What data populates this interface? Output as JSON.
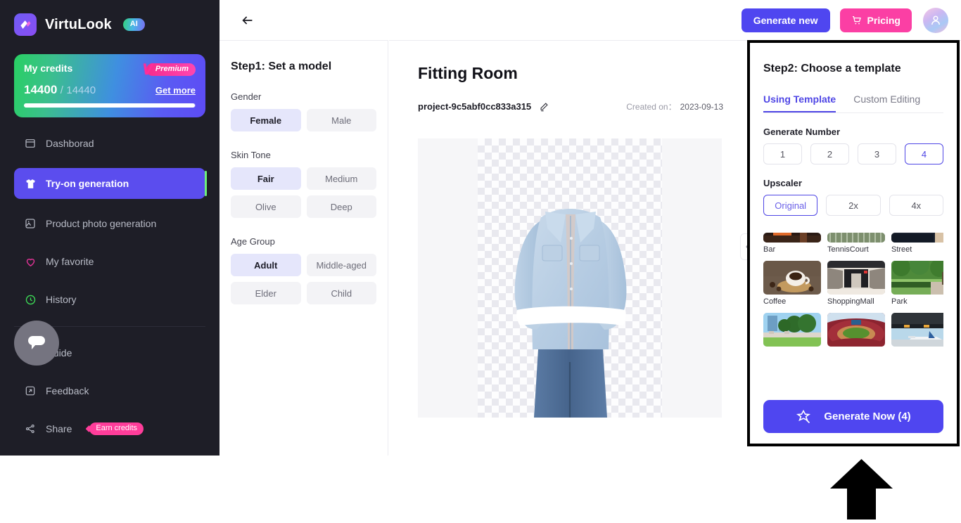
{
  "brand": {
    "name": "VirtuLook",
    "ai_badge": "AI"
  },
  "credits": {
    "title": "My credits",
    "premium_label": "Premium",
    "premium_mark": "V",
    "used": "14400",
    "separator": "/",
    "total": "14440",
    "get_more": "Get more",
    "progress_percent": 99.7
  },
  "sidebar": {
    "items": [
      {
        "label": "Dashborad",
        "icon": "dashboard-icon",
        "active": false
      },
      {
        "label": "Try-on generation",
        "icon": "tshirt-icon",
        "active": true
      },
      {
        "label": "Product photo generation",
        "icon": "image-icon",
        "active": false
      },
      {
        "label": "My favorite",
        "icon": "heart-icon",
        "active": false
      },
      {
        "label": "History",
        "icon": "clock-icon",
        "active": false
      }
    ],
    "bottom_items": [
      {
        "label": "Guide",
        "icon": "question-circle-icon"
      },
      {
        "label": "Feedback",
        "icon": "external-link-icon"
      },
      {
        "label": "Share",
        "icon": "share-icon",
        "badge": "Earn credits"
      }
    ]
  },
  "topbar": {
    "back_icon": "arrow-left-icon",
    "generate_new": "Generate new",
    "pricing": "Pricing",
    "pricing_icon": "cart-icon",
    "avatar_icon": "user-icon"
  },
  "step1": {
    "title": "Step1: Set a model",
    "groups": [
      {
        "label": "Gender",
        "options": [
          {
            "text": "Female",
            "selected": true
          },
          {
            "text": "Male",
            "selected": false
          }
        ]
      },
      {
        "label": "Skin Tone",
        "options": [
          {
            "text": "Fair",
            "selected": true
          },
          {
            "text": "Medium",
            "selected": false
          },
          {
            "text": "Olive",
            "selected": false
          },
          {
            "text": "Deep",
            "selected": false
          }
        ]
      },
      {
        "label": "Age Group",
        "options": [
          {
            "text": "Adult",
            "selected": true
          },
          {
            "text": "Middle-aged",
            "selected": false
          },
          {
            "text": "Elder",
            "selected": false
          },
          {
            "text": "Child",
            "selected": false
          }
        ]
      }
    ]
  },
  "center": {
    "title": "Fitting Room",
    "project_name": "project-9c5abf0cc833a315",
    "edit_icon": "pencil-icon",
    "created_on_label": "Created on：",
    "created_on_value": "2023-09-13",
    "garment_alt": "light-blue denim shirt with jeans on transparent background"
  },
  "step2": {
    "title": "Step2: Choose a template",
    "tabs": [
      {
        "label": "Using Template",
        "active": true
      },
      {
        "label": "Custom Editing",
        "active": false
      }
    ],
    "generate_number_label": "Generate Number",
    "generate_numbers": [
      {
        "text": "1",
        "selected": false
      },
      {
        "text": "2",
        "selected": false
      },
      {
        "text": "3",
        "selected": false
      },
      {
        "text": "4",
        "selected": true
      }
    ],
    "upscaler_label": "Upscaler",
    "upscaler_options": [
      {
        "text": "Original",
        "selected": true
      },
      {
        "text": "2x",
        "selected": false
      },
      {
        "text": "4x",
        "selected": false
      }
    ],
    "templates": [
      {
        "name": "Bar",
        "clipped": true
      },
      {
        "name": "TennisCourt",
        "clipped": true
      },
      {
        "name": "Street",
        "clipped": true
      },
      {
        "name": "Coffee",
        "clipped": false
      },
      {
        "name": "ShoppingMall",
        "clipped": false
      },
      {
        "name": "Park",
        "clipped": false
      },
      {
        "name": "",
        "clipped": false
      },
      {
        "name": "",
        "clipped": false
      },
      {
        "name": "",
        "clipped": false
      }
    ],
    "generate_now": "Generate Now (4)",
    "generate_now_icon": "magic-wand-star-icon",
    "collapse_icon": "chevron-left-icon"
  },
  "annotation": {
    "arrow_icon": "up-arrow-annotation"
  },
  "colors": {
    "accent_purple": "#4f46f0",
    "accent_pink": "#fb3fa4",
    "sidebar_bg": "#1e1e27",
    "active_nav": "#5b4dee",
    "active_edge_green": "#6ef07a"
  }
}
